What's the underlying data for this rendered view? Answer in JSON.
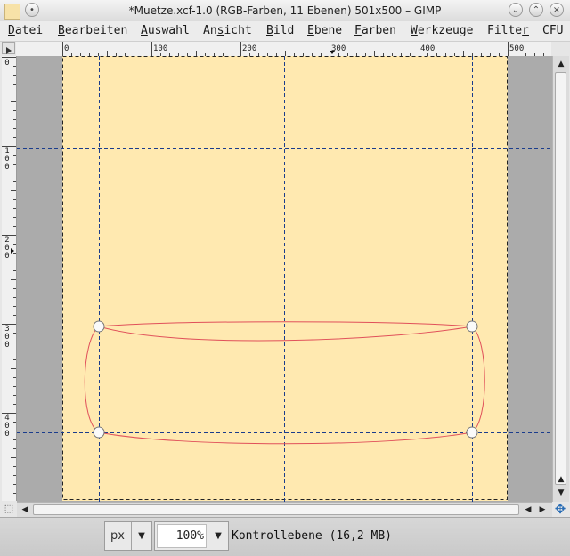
{
  "window": {
    "title": "*Muetze.xcf-1.0 (RGB-Farben, 11 Ebenen) 501x500 – GIMP",
    "close_icon": "×",
    "shade_icon": "•",
    "minimize_icon": "⌄",
    "maximize_icon": "⌃"
  },
  "menubar": {
    "items": [
      {
        "label": "Datei",
        "accel": "D",
        "rest": "atei"
      },
      {
        "label": "Bearbeiten",
        "accel": "B",
        "rest": "earbeiten"
      },
      {
        "label": "Auswahl",
        "accel": "A",
        "rest": "uswahl"
      },
      {
        "label": "Ansicht",
        "pre": "An",
        "accel": "s",
        "rest": "icht"
      },
      {
        "label": "Bild",
        "accel": "B",
        "rest": "ild"
      },
      {
        "label": "Ebene",
        "accel": "E",
        "rest": "bene"
      },
      {
        "label": "Farben",
        "accel": "F",
        "rest": "arben"
      },
      {
        "label": "Werkzeuge",
        "accel": "W",
        "rest": "erkzeuge"
      },
      {
        "label": "Filter",
        "pre": "Filte",
        "accel": "r",
        "rest": ""
      },
      {
        "label": "CFU"
      }
    ]
  },
  "rulers": {
    "horizontal": [
      "0",
      "100",
      "200",
      "300",
      "400",
      "500"
    ],
    "vertical": [
      "0",
      "100",
      "200",
      "300",
      "400"
    ]
  },
  "canvas": {
    "background_color": "#ababab",
    "image_color": "#ffe9b0",
    "guide_color": "#1a3c8c",
    "path_color": "#e0505a"
  },
  "statusbar": {
    "unit": "px",
    "zoom": "100",
    "zoom_unit": "%",
    "message": "Kontrollebene (16,2 MB)"
  }
}
